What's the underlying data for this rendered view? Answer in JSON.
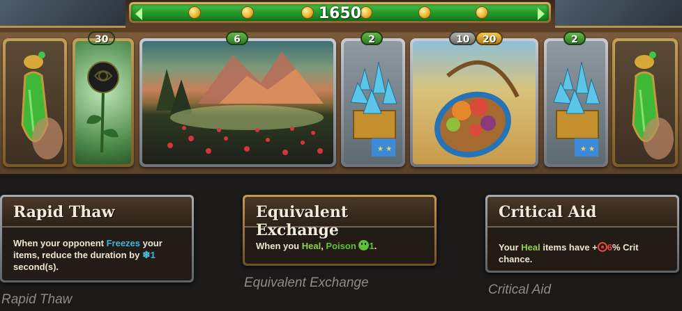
{
  "hud": {
    "gold": "1650"
  },
  "board": {
    "cards": [
      {
        "name": "green-potion-left",
        "badge": "",
        "badge_style": ""
      },
      {
        "name": "black-rose",
        "badge": "30",
        "badge_style": "grey"
      },
      {
        "name": "flower-field",
        "badge": "6",
        "badge_style": "green"
      },
      {
        "name": "blue-crystal-box",
        "badge": "2",
        "badge_style": "green"
      },
      {
        "name": "fruit-basket",
        "badge": "10",
        "badge_style": "grey",
        "badge2": "20",
        "badge2_style": "gold"
      },
      {
        "name": "blue-crystal-box-2",
        "badge": "2",
        "badge_style": "green"
      },
      {
        "name": "green-potion-right",
        "badge": "",
        "badge_style": ""
      }
    ]
  },
  "tooltips": [
    {
      "title": "Rapid Thaw",
      "body": {
        "t1": "When your opponent ",
        "kw": "Freezes",
        "t2": " your items, reduce the duration by ",
        "icon": "snowflake-icon",
        "num": "1",
        "t3": " second(s)."
      },
      "caption": "Rapid Thaw"
    },
    {
      "title": "Equivalent Exchange",
      "body": {
        "t1": "When you ",
        "kw1": "Heal",
        "sep": ", ",
        "kw2": "Poison",
        "icon": "skull-icon",
        "num": "1",
        "t2": "."
      },
      "caption": "Equivalent Exchange"
    },
    {
      "title": "Critical Aid",
      "body": {
        "t1": "Your ",
        "kw": "Heal",
        "t2": " items have +",
        "icon": "crit-icon",
        "num": "6",
        "t3": "% Crit chance."
      },
      "caption": "Critical Aid"
    }
  ]
}
